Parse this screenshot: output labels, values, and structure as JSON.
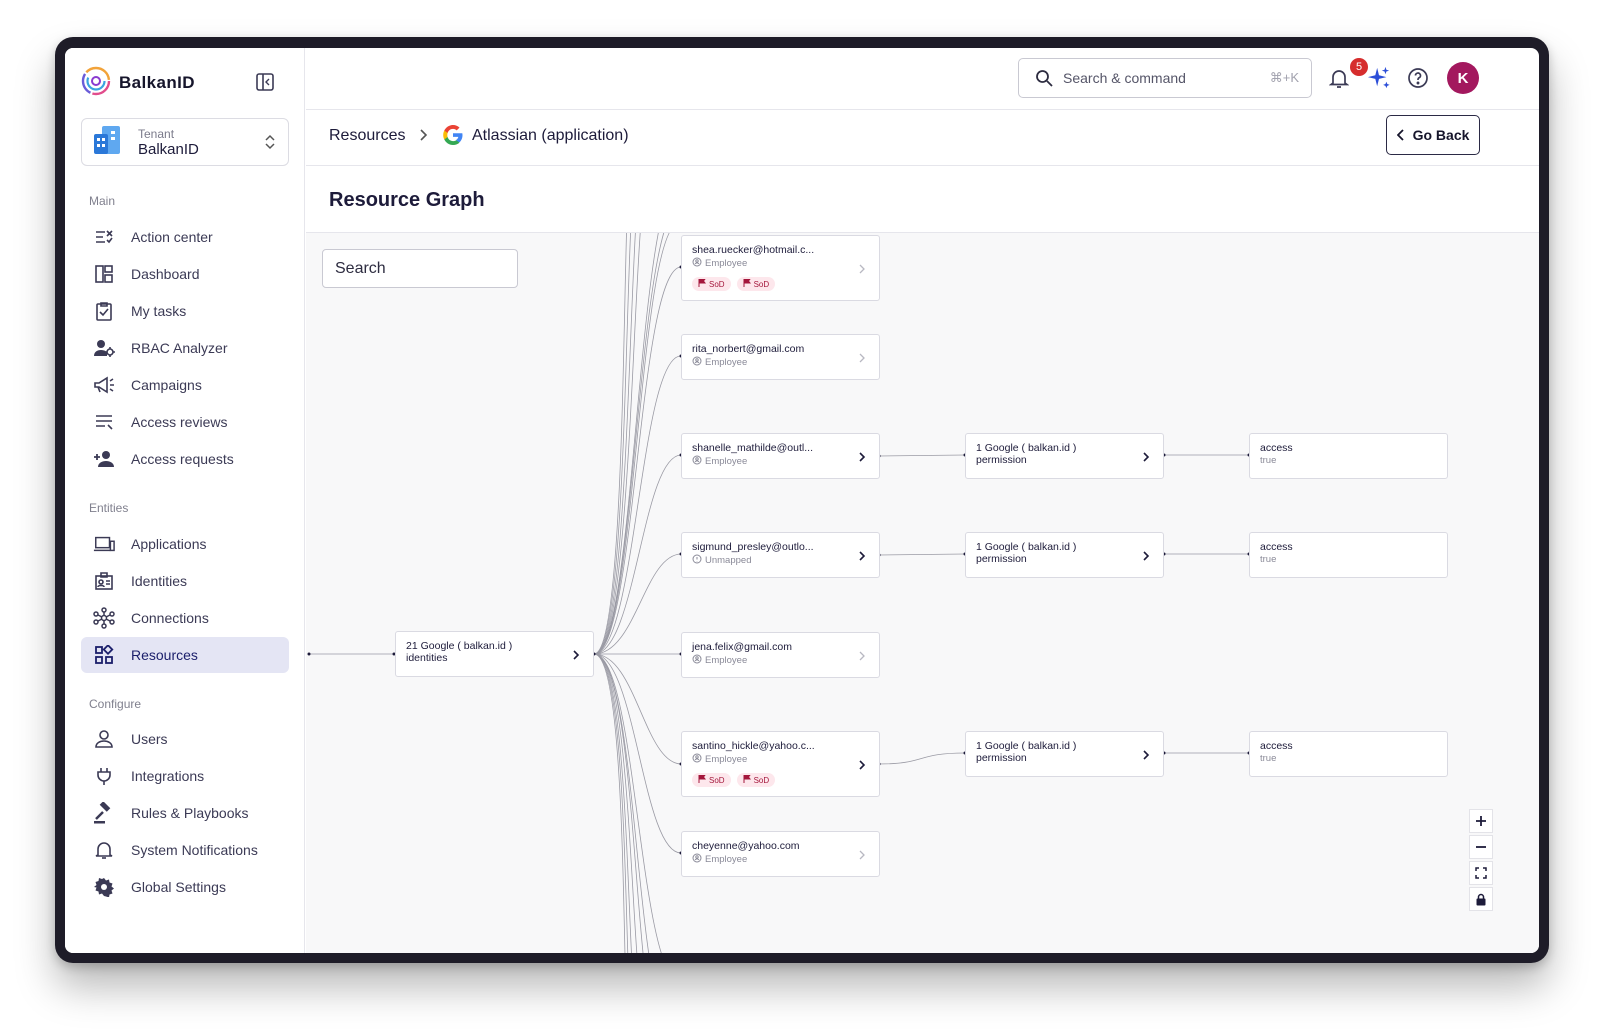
{
  "brand": {
    "name": "BalkanID"
  },
  "tenant": {
    "label": "Tenant",
    "value": "BalkanID"
  },
  "sidebar": {
    "main_label": "Main",
    "main": [
      {
        "label": "Action center",
        "icon": "action-center-icon"
      },
      {
        "label": "Dashboard",
        "icon": "dashboard-icon"
      },
      {
        "label": "My tasks",
        "icon": "tasks-icon"
      },
      {
        "label": "RBAC Analyzer",
        "icon": "rbac-icon"
      },
      {
        "label": "Campaigns",
        "icon": "megaphone-icon"
      },
      {
        "label": "Access reviews",
        "icon": "list-icon"
      },
      {
        "label": "Access requests",
        "icon": "person-add-icon"
      }
    ],
    "entities_label": "Entities",
    "entities": [
      {
        "label": "Applications",
        "icon": "devices-icon"
      },
      {
        "label": "Identities",
        "icon": "id-badge-icon"
      },
      {
        "label": "Connections",
        "icon": "network-icon"
      },
      {
        "label": "Resources",
        "icon": "grid-icon",
        "active": true
      }
    ],
    "configure_label": "Configure",
    "configure": [
      {
        "label": "Users",
        "icon": "user-icon"
      },
      {
        "label": "Integrations",
        "icon": "plug-icon"
      },
      {
        "label": "Rules & Playbooks",
        "icon": "gavel-icon"
      },
      {
        "label": "System Notifications",
        "icon": "bell-icon"
      },
      {
        "label": "Global Settings",
        "icon": "gear-icon"
      }
    ]
  },
  "header": {
    "search_label": "Search & command",
    "search_shortcut": "⌘+K",
    "notification_count": "5",
    "avatar_initial": "K"
  },
  "breadcrumb": {
    "root": "Resources",
    "current": "Atlassian (application)",
    "go_back": "Go Back"
  },
  "page": {
    "title": "Resource Graph"
  },
  "graph": {
    "search_placeholder": "Search",
    "root_node": {
      "title": "21 Google ( balkan.id )",
      "subtitle": "identities"
    },
    "identities": [
      {
        "title": "shea.ruecker@hotmail.c...",
        "type": "Employee",
        "tags": [
          "SoD",
          "SoD"
        ],
        "expandable": false
      },
      {
        "title": "rita_norbert@gmail.com",
        "type": "Employee",
        "tags": [],
        "expandable": false
      },
      {
        "title": "shanelle_mathilde@outl...",
        "type": "Employee",
        "tags": [],
        "expandable": true
      },
      {
        "title": "sigmund_presley@outlo...",
        "type": "Unmapped",
        "tags": [],
        "expandable": true
      },
      {
        "title": "jena.felix@gmail.com",
        "type": "Employee",
        "tags": [],
        "expandable": false
      },
      {
        "title": "santino_hickle@yahoo.c...",
        "type": "Employee",
        "tags": [
          "SoD",
          "SoD"
        ],
        "expandable": true
      },
      {
        "title": "cheyenne@yahoo.com",
        "type": "Employee",
        "tags": [],
        "expandable": false
      }
    ],
    "permissions": [
      {
        "title": "1 Google ( balkan.id )",
        "subtitle": "permission",
        "access_label": "access",
        "access_value": "true"
      },
      {
        "title": "1 Google ( balkan.id )",
        "subtitle": "permission",
        "access_label": "access",
        "access_value": "true"
      },
      {
        "title": "1 Google ( balkan.id )",
        "subtitle": "permission",
        "access_label": "access",
        "access_value": "true"
      }
    ]
  },
  "controls": [
    "zoom-in",
    "zoom-out",
    "fit-view",
    "lock"
  ]
}
